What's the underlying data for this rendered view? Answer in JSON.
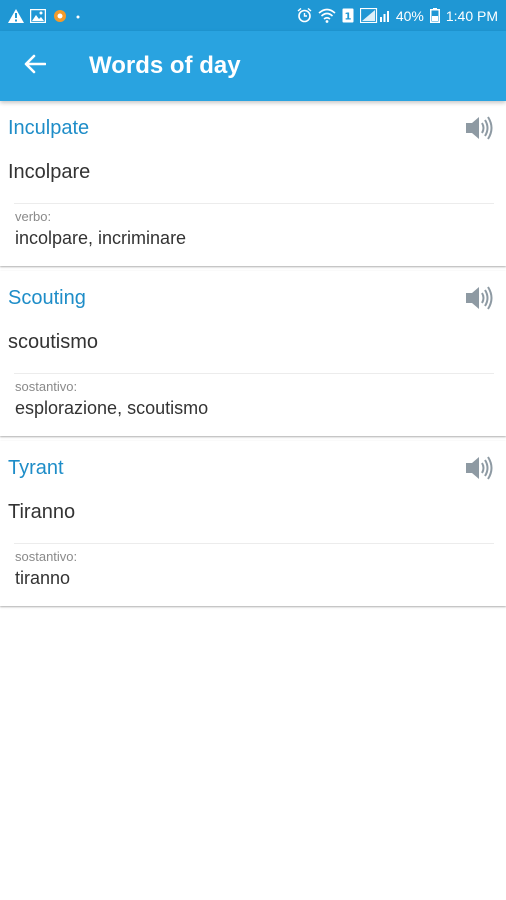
{
  "status_bar": {
    "battery_percent": "40%",
    "time": "1:40 PM",
    "left_icons": [
      "warning-icon",
      "image-icon",
      "app-notification-icon",
      "dot-icon"
    ],
    "right_icons": [
      "alarm-icon",
      "wifi-icon",
      "sim-icon",
      "signal-icon",
      "battery-icon"
    ]
  },
  "header": {
    "title": "Words of day",
    "back_icon": "arrow-left-icon",
    "color": "#29a3e0"
  },
  "words": [
    {
      "word": "Inculpate",
      "translation": "Incolpare",
      "part_of_speech": "verbo:",
      "meanings": "incolpare, incriminare"
    },
    {
      "word": "Scouting",
      "translation": "scoutismo",
      "part_of_speech": "sostantivo:",
      "meanings": "esplorazione, scoutismo"
    },
    {
      "word": "Tyrant",
      "translation": "Tiranno",
      "part_of_speech": "sostantivo:",
      "meanings": "tiranno"
    }
  ],
  "colors": {
    "accent": "#1e8dc8",
    "status_bar": "#1f97d4"
  }
}
